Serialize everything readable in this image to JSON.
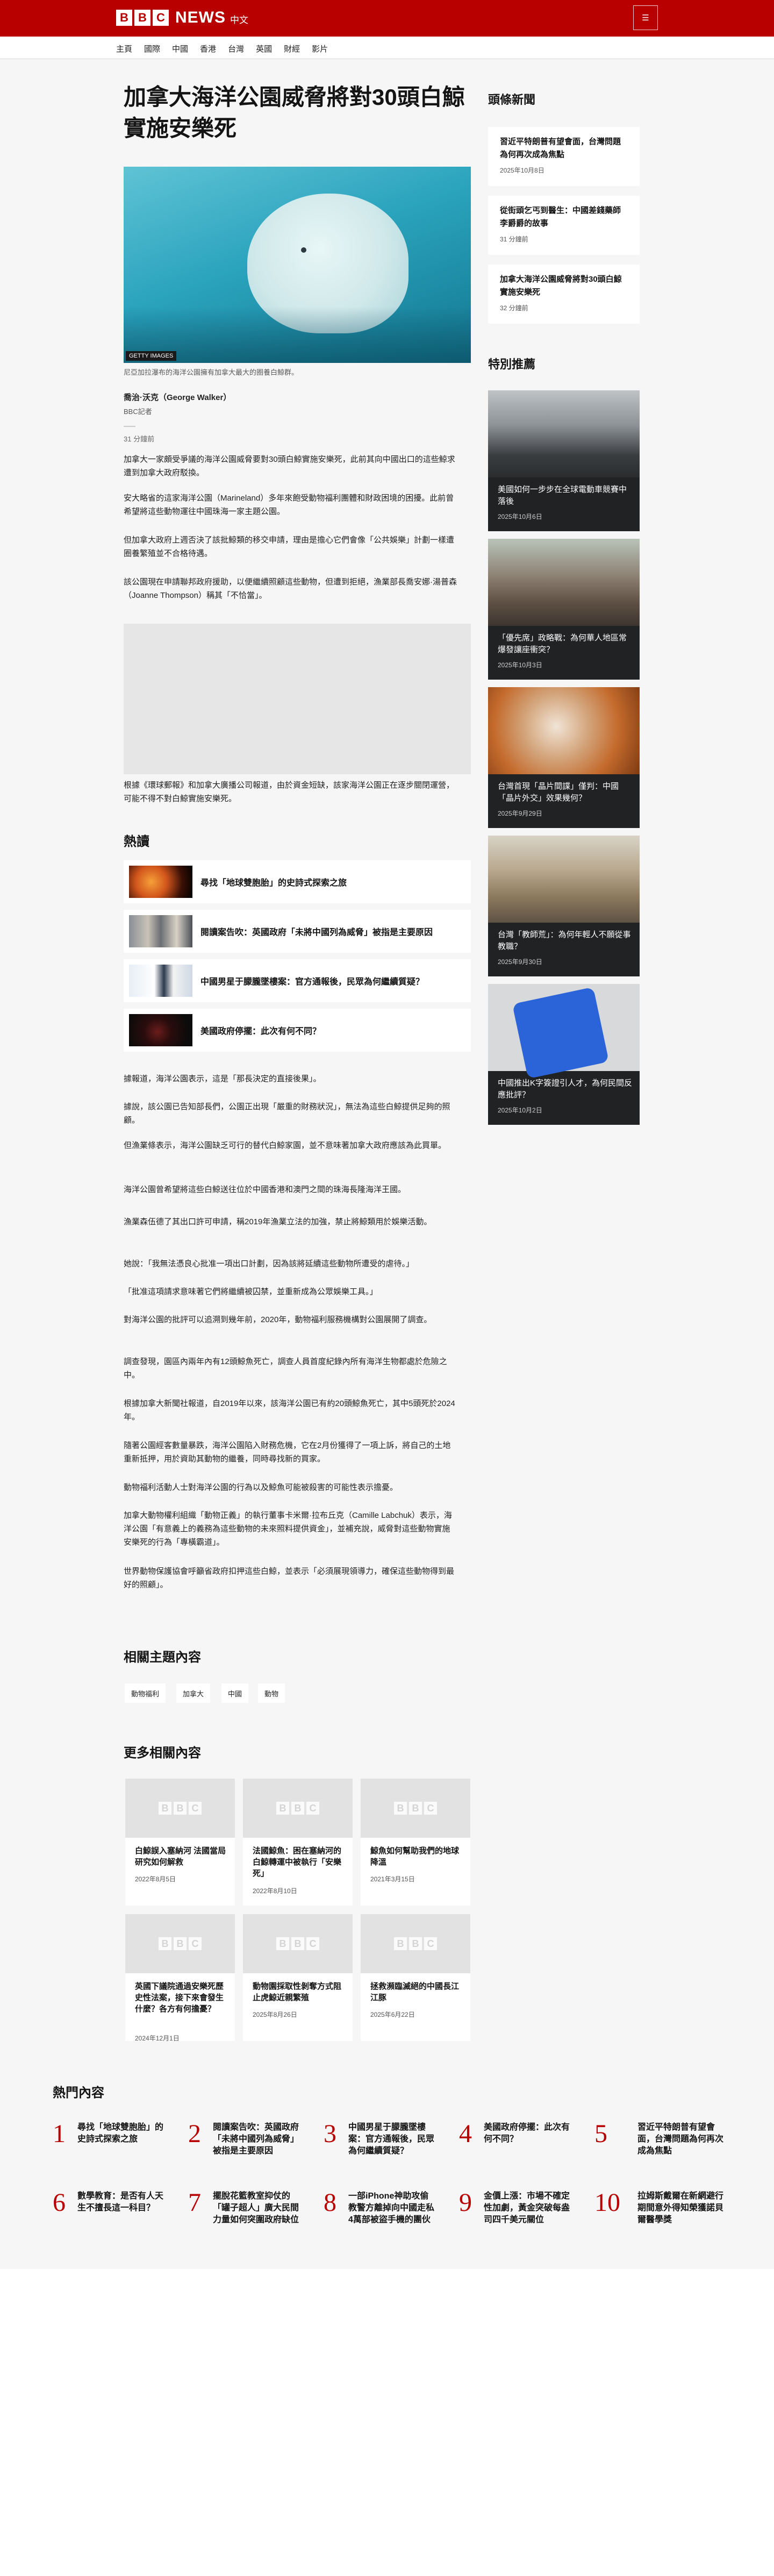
{
  "header": {
    "brand_letters": [
      "B",
      "B",
      "C"
    ],
    "brand_news": "NEWS",
    "brand_sub": "中文",
    "menu_label": "☰"
  },
  "nav": [
    "主頁",
    "國際",
    "中國",
    "香港",
    "台灣",
    "英國",
    "財經",
    "影片"
  ],
  "article": {
    "headline": "加拿大海洋公園威脅將對30頭白鯨實施安樂死",
    "image_credit": "GETTY IMAGES",
    "caption": "尼亞加拉瀑布的海洋公園擁有加拿大最大的圈養白鯨群。",
    "author_name": "喬治·沃克（George Walker）",
    "author_role": "BBC記者",
    "time_ago": "31 分鐘前",
    "intro_paragraphs": [
      "加拿大一家頗受爭議的海洋公園威脅要對30頭白鯨實施安樂死，此前其向中國出口的這些鯨求遭到加拿大政府駁換。",
      "安大略省的這家海洋公園（Marineland）多年來飽受動物福利團體和財政困境的困擾。此前曾希望將這些動物運往中國珠海一家主題公園。",
      "但加拿大政府上週否決了該批鯨類的移交申請，理由是擔心它們會像「公共娛樂」計劃一樣遭圈養繁殖並不合格待遇。",
      "該公園現在申請聯邦政府援助，以便繼續照顧這些動物，但遭到拒絕，漁業部長喬安娜·湯普森（Joanne Thompson）稱其「不恰當」。"
    ],
    "after_embed_paragraph": "根據《環球郵報》和加拿大廣播公司報道，由於資金短缺，該家海洋公園正在逐步關閉運營，可能不得不對白鯨實施安樂死。",
    "body_paragraphs": [
      "據報道，海洋公園表示，這是「那長決定的直接後果」。",
      "據說，該公園已告知部長們，公園正出現「嚴重的財務狀況」，無法為這些白鯨提供足夠的照顧。",
      "但漁業條表示，海洋公園缺乏可行的替代白鯨家園，並不意味著加拿大政府應該為此買單。",
      "海洋公園曾希望將這些白鯨送往位於中國香港和澳門之間的珠海長隆海洋王國。",
      "漁業森伍德了其出口許可申請，稱2019年漁業立法的加強，禁止將鯨類用於娛樂活動。",
      "她說：「我無法憑良心批准一項出口計劃，因為該將延續這些動物所遭受的虐待。」",
      "「批准這項請求意味著它們將繼續被囚禁，並重新成為公眾娛樂工具。」",
      "對海洋公園的批評可以追溯到幾年前，2020年，動物福利服務機構對公園展開了調查。",
      "調查發現，園區內兩年內有12頭鯨魚死亡，調查人員首度紀錄內所有海洋生物都處於危險之中。",
      "根據加拿大新聞社報道，自2019年以來，該海洋公園已有約20頭鯨魚死亡，其中5頭死於2024年。",
      "隨著公園經客數量暴跌，海洋公園陷入財務危機，它在2月份獲得了一項上訴，將自己的土地重新抵押，用於資助其動物的繼養，同時尋找新的買家。",
      "動物福利活動人士對海洋公園的行為以及鯨魚可能被殺害的可能性表示擔憂。",
      "加拿大動物權利組織「動物正義」的執行董事卡米爾·拉布丘克（Camille Labchuk）表示，海洋公園「有意義上的義務為這些動物的未來照料提供資金」，並補充說，威脅對這些動物實施安樂死的行為「專橫霸道」。",
      "世界動物保護協會呼籲省政府扣押這些白鯨，並表示「必須展現領導力，確保這些動物得到最好的照顧」。"
    ]
  },
  "hot_topics": {
    "heading": "熱讀",
    "items": [
      "尋找「地球雙胞胎」的史詩式探索之旅",
      "閱讀案告吹：英國政府「未將中國列為威脅」被指是主要原因",
      "中國男星于朦朧墜樓案：官方通報後，民眾為何繼續質疑？",
      "美國政府停擺：此次有何不同？"
    ]
  },
  "sidebar": {
    "top_news_heading": "頭條新聞",
    "top_news": [
      {
        "title": "習近平特朗普有望會面，台灣問題為何再次成為焦點",
        "date": "2025年10月8日"
      },
      {
        "title": "從街頭乞丐到醫生：中國差錢藥師李爵爵的故事",
        "date": "31 分鐘前"
      },
      {
        "title": "加拿大海洋公園威脅將對30頭白鯨實施安樂死",
        "date": "32 分鐘前"
      }
    ],
    "featured_heading": "特別推薦",
    "featured": [
      {
        "title": "美國如何一步步在全球電動車競賽中落後",
        "date": "2025年10月6日"
      },
      {
        "title": "「優先席」政略戰：為何華人地區常爆發讓座衝突？",
        "date": "2025年10月3日"
      },
      {
        "title": "台灣首現「晶片間諜」僅判：中國「晶片外交」效果幾何？",
        "date": "2025年9月29日"
      },
      {
        "title": "台灣「教師荒」：為何年輕人不願從事教職？",
        "date": "2025年9月30日"
      },
      {
        "title": "中國推出K字簽證引人才，為何民間反應批評？",
        "date": "2025年10月2日"
      }
    ]
  },
  "related_topics": {
    "heading": "相關主題內容",
    "tags": [
      "動物福利",
      "加拿大",
      "中國",
      "動物"
    ]
  },
  "more_related": {
    "heading": "更多相關內容",
    "logo_letters": [
      "B",
      "B",
      "C"
    ],
    "cards": [
      {
        "title": "白鯨誤入塞納河 法國當局研究如何解救",
        "date": "2022年8月5日"
      },
      {
        "title": "法國鯨魚：困在塞納河的白鯨轉運中被執行「安樂死」",
        "date": "2022年8月10日"
      },
      {
        "title": "鯨魚如何幫助我們的地球降溫",
        "date": "2021年3月15日"
      },
      {
        "title": "英國下議院通過安樂死歷史性法案，接下來會發生什麼？各方有何擔憂？",
        "date": "2024年12月1日"
      },
      {
        "title": "動物園採取性剝奪方式阻止虎鯨近親繁殖",
        "date": "2025年8月26日"
      },
      {
        "title": "拯救瀕臨滅絕的中國長江江豚",
        "date": "2025年6月22日"
      }
    ]
  },
  "most_read": {
    "heading": "熱門內容",
    "items": [
      {
        "num": "1",
        "title": "尋找「地球雙胞胎」的史詩式探索之旅"
      },
      {
        "num": "2",
        "title": "閱讀案告吹：英國政府「未將中國列為威脅」被指是主要原因"
      },
      {
        "num": "3",
        "title": "中國男星于朦朧墜樓案：官方通報後，民眾為何繼續質疑？"
      },
      {
        "num": "4",
        "title": "美國政府停擺：此次有何不同？"
      },
      {
        "num": "5",
        "title": "習近平特朗普有望會面，台灣問題為何再次成為焦點"
      },
      {
        "num": "6",
        "title": "數學教育：是否有人天生不擅長這一科目？"
      },
      {
        "num": "7",
        "title": "擺脫花籃教室抑仗的「罐子超人」廣大民間力量如何突圍政府缺位"
      },
      {
        "num": "8",
        "title": "一部iPhone神助攻偷教警方離掉向中國走私4萬部被盜手機的團伙"
      },
      {
        "num": "9",
        "title": "金價上漲：市場不確定性加劇，黃金突破每盎司四千美元關位"
      },
      {
        "num": "10",
        "title": "拉姆斯戴爾在新網避行期間意外得知榮獲諾貝爾醫學獎"
      }
    ]
  }
}
